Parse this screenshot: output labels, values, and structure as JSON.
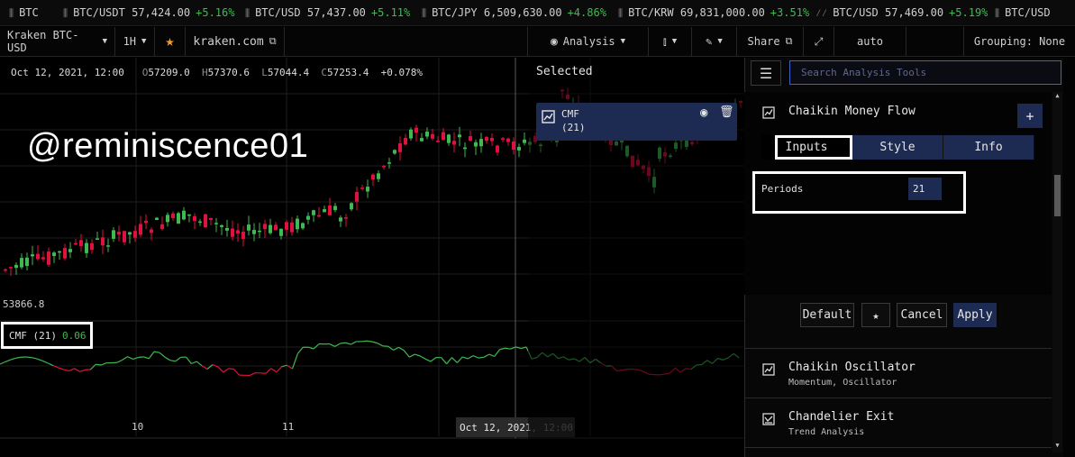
{
  "ticker": [
    {
      "pair": "BTC",
      "price": "",
      "change": ""
    },
    {
      "pair": "BTC/USDT",
      "price": "57,424.00",
      "change": "+5.16%"
    },
    {
      "pair": "BTC/USD",
      "price": "57,437.00",
      "change": "+5.11%"
    },
    {
      "pair": "BTC/JPY",
      "price": "6,509,630.00",
      "change": "+4.86%"
    },
    {
      "pair": "BTC/KRW",
      "price": "69,831,000.00",
      "change": "+3.51%"
    },
    {
      "pair": "BTC/USD",
      "price": "57,469.00",
      "change": "+5.19%"
    },
    {
      "pair": "BTC/USD",
      "price": "",
      "change": ""
    }
  ],
  "toolbar": {
    "symbol": "Kraken BTC-USD",
    "interval": "1H",
    "site": "kraken.com",
    "analysis": "Analysis",
    "share": "Share",
    "auto": "auto",
    "grouping": "Grouping: None"
  },
  "ohlc": {
    "date": "Oct 12, 2021, 12:00",
    "o_key": "O",
    "o": "57209.0",
    "h_key": "H",
    "h": "57370.6",
    "l_key": "L",
    "l": "57044.4",
    "c_key": "C",
    "c": "57253.4",
    "change": "+0.078%"
  },
  "watermark": "@reminiscence01",
  "price_low_label": "53866.8",
  "indicator": {
    "name": "CMF (21)",
    "value": "0.06"
  },
  "xaxis": {
    "d10": "10",
    "d11": "11",
    "crosshair_date": "Oct 12, 2021",
    "crosshair_time": ", 12:00"
  },
  "selected": {
    "header": "Selected",
    "item_name": "CMF",
    "item_param": "(21)"
  },
  "panel": {
    "search_placeholder": "Search Analysis Tools",
    "title": "Chaikin Money Flow",
    "plus": "+",
    "tabs": [
      "Inputs",
      "Style",
      "Info"
    ],
    "periods_label": "Periods",
    "periods_value": "21",
    "default_btn": "Default",
    "star_btn": "★",
    "cancel_btn": "Cancel",
    "apply_btn": "Apply",
    "tools": [
      {
        "name": "Chaikin Oscillator",
        "sub": "Momentum, Oscillator"
      },
      {
        "name": "Chandelier Exit",
        "sub": "Trend Analysis"
      }
    ]
  },
  "colors": {
    "up": "#3fb950",
    "down": "#e0123d",
    "accent": "#1d2b52",
    "focus": "#3a63c8"
  }
}
